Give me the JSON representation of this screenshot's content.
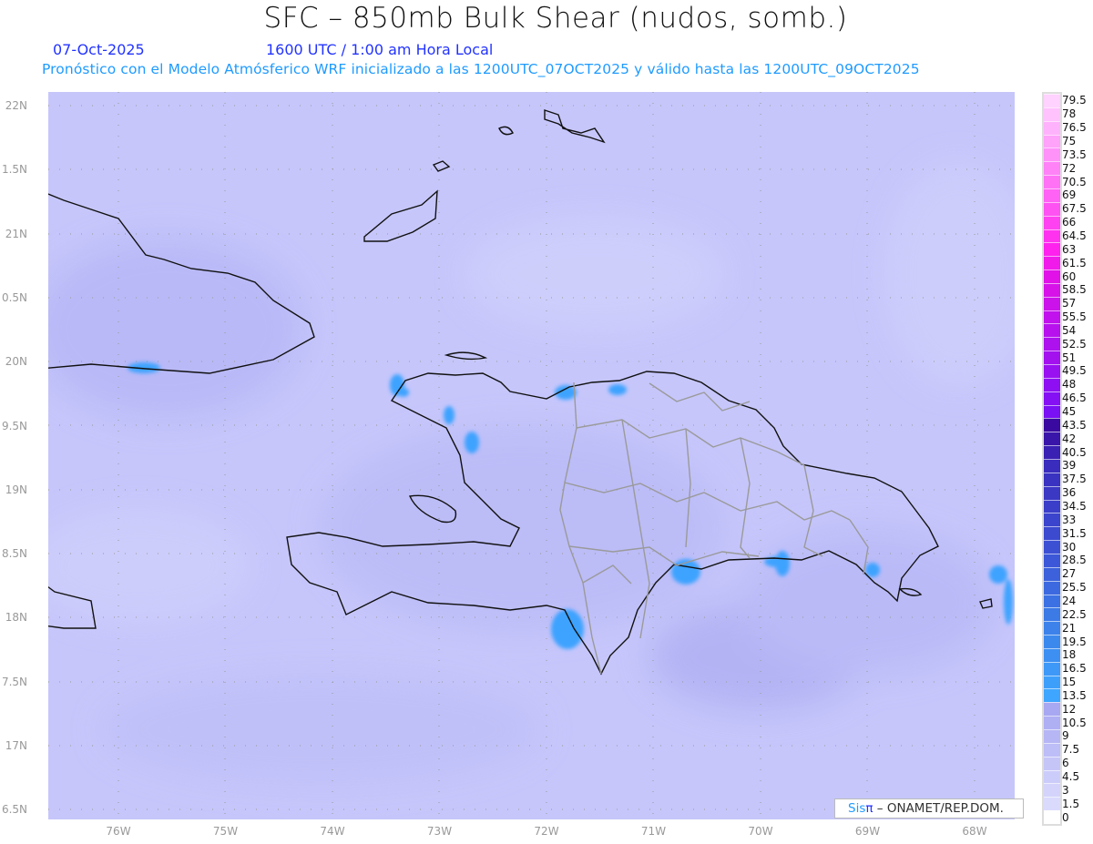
{
  "header": {
    "title": "SFC – 850mb Bulk Shear (nudos, somb.)",
    "date": "07-Oct-2025",
    "time": "1600 UTC / 1:00 am Hora Local",
    "description": "Pronóstico con el Modelo Atmósferico WRF inicializado a las 1200UTC_07OCT2025 y válido hasta las  1200UTC_09OCT2025"
  },
  "map": {
    "lat_labels": [
      "22N",
      "1.5N",
      "21N",
      "0.5N",
      "20N",
      "9.5N",
      "19N",
      "8.5N",
      "18N",
      "7.5N",
      "17N",
      "6.5N"
    ],
    "lon_labels": [
      "76W",
      "75W",
      "74W",
      "73W",
      "72W",
      "71W",
      "70W",
      "69W",
      "68W"
    ],
    "field_color": "#c4c4fa",
    "high_shear_color": "#3ea3ff"
  },
  "colorbar": {
    "values": [
      "0",
      "1.5",
      "3",
      "4.5",
      "6",
      "7.5",
      "9",
      "10.5",
      "12",
      "13.5",
      "15",
      "16.5",
      "18",
      "19.5",
      "21",
      "22.5",
      "24",
      "25.5",
      "27",
      "28.5",
      "30",
      "31.5",
      "33",
      "34.5",
      "36",
      "37.5",
      "39",
      "40.5",
      "42",
      "43.5",
      "45",
      "46.5",
      "48",
      "49.5",
      "51",
      "52.5",
      "54",
      "55.5",
      "57",
      "58.5",
      "60",
      "61.5",
      "63",
      "64.5",
      "66",
      "67.5",
      "69",
      "70.5",
      "72",
      "73.5",
      "75",
      "76.5",
      "78",
      "79.5"
    ],
    "stops": [
      [
        0,
        "#ffffff"
      ],
      [
        1,
        "#dadafd"
      ],
      [
        8,
        "#a8a8f2"
      ],
      [
        9,
        "#3ea6ff"
      ],
      [
        14,
        "#3c82ea"
      ],
      [
        20,
        "#3c50d4"
      ],
      [
        26,
        "#3a2cbc"
      ],
      [
        29,
        "#3a0aa0"
      ],
      [
        30,
        "#7a10f4"
      ],
      [
        40,
        "#e012e8"
      ],
      [
        42,
        "#ff22ee"
      ],
      [
        53,
        "#ffd2ff"
      ]
    ]
  },
  "credit": {
    "brand_a": "Sis",
    "brand_b": "π",
    "text": " – ONAMET/REP.DOM."
  }
}
